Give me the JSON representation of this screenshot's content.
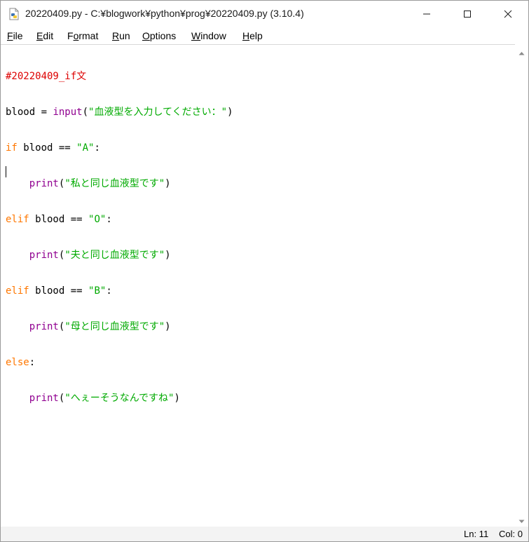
{
  "window": {
    "title": "20220409.py - C:¥blogwork¥python¥prog¥20220409.py (3.10.4)"
  },
  "menu": {
    "file": {
      "acc": "F",
      "rest": "ile"
    },
    "edit": {
      "acc": "E",
      "rest": "dit"
    },
    "format": {
      "pre": "F",
      "acc": "o",
      "rest": "rmat"
    },
    "run": {
      "acc": "R",
      "rest": "un"
    },
    "options": {
      "acc": "O",
      "rest": "ptions"
    },
    "window": {
      "acc": "W",
      "rest": "indow"
    },
    "help": {
      "acc": "H",
      "rest": "elp"
    }
  },
  "code": {
    "l1": {
      "comment": "#20220409_if文"
    },
    "l2": {
      "var": "blood = ",
      "fn": "input",
      "open": "(",
      "str": "\"血液型を入力してください：\"",
      "close": ")"
    },
    "l3": {
      "kw": "if",
      "rest": " blood == ",
      "str": "\"A\"",
      "colon": ":"
    },
    "l4": {
      "indent": "    ",
      "fn": "print",
      "open": "(",
      "str": "\"私と同じ血液型です\"",
      "close": ")"
    },
    "l5": {
      "kw": "elif",
      "rest": " blood == ",
      "str": "\"O\"",
      "colon": ":"
    },
    "l6": {
      "indent": "    ",
      "fn": "print",
      "open": "(",
      "str": "\"夫と同じ血液型です\"",
      "close": ")"
    },
    "l7": {
      "kw": "elif",
      "rest": " blood == ",
      "str": "\"B\"",
      "colon": ":"
    },
    "l8": {
      "indent": "    ",
      "fn": "print",
      "open": "(",
      "str": "\"母と同じ血液型です\"",
      "close": ")"
    },
    "l9": {
      "kw": "else",
      "colon": ":"
    },
    "l10": {
      "indent": "    ",
      "fn": "print",
      "open": "(",
      "str": "\"へぇーそうなんですね\"",
      "close": ")"
    }
  },
  "status": {
    "ln": "Ln: 11",
    "col": "Col: 0"
  },
  "colors": {
    "keyword": "#ff7700",
    "builtin": "#900090",
    "string": "#00aa00",
    "comment": "#dd0000"
  },
  "icons": {
    "app": "python-idle-icon",
    "minimize": "minimize-icon",
    "maximize": "maximize-icon",
    "close": "close-icon"
  }
}
